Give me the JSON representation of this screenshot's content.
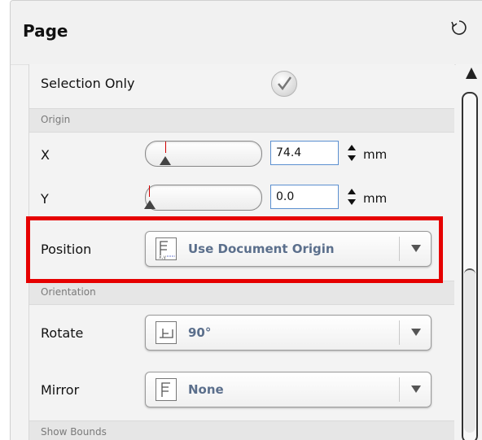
{
  "panel": {
    "title": "Page",
    "refresh_icon": "refresh-icon"
  },
  "selection_only": {
    "label": "Selection Only",
    "checked": true
  },
  "sections": {
    "origin": "Origin",
    "orientation": "Orientation",
    "show_bounds": "Show Bounds"
  },
  "x": {
    "label": "X",
    "value": "74.4",
    "unit": "mm"
  },
  "y": {
    "label": "Y",
    "value": "0.0",
    "unit": "mm"
  },
  "position": {
    "label": "Position",
    "value": "Use Document Origin",
    "icon": "document-origin-icon"
  },
  "rotate": {
    "label": "Rotate",
    "value": "90°",
    "icon": "rotate-icon"
  },
  "mirror": {
    "label": "Mirror",
    "value": "None",
    "icon": "mirror-icon"
  },
  "colors": {
    "highlight": "#e60000",
    "field_border": "#5b8fd0",
    "combo_text": "#5b6f8c"
  }
}
